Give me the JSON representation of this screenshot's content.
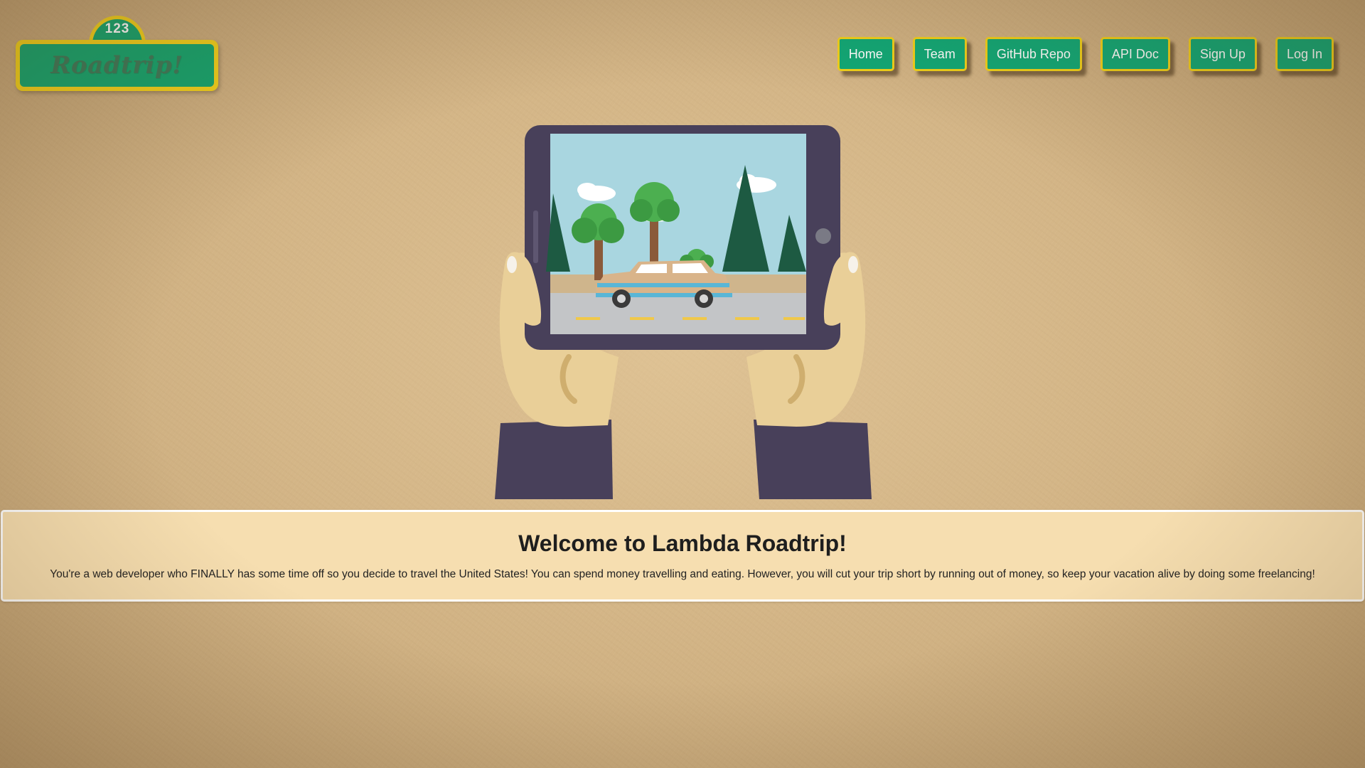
{
  "logo": {
    "number": "123",
    "text": "Roadtrip!"
  },
  "nav": {
    "items": [
      {
        "label": "Home"
      },
      {
        "label": "Team"
      },
      {
        "label": "GitHub Repo"
      },
      {
        "label": "API Doc"
      },
      {
        "label": "Sign Up"
      },
      {
        "label": "Log In"
      }
    ]
  },
  "hero": {
    "illustration": "hands-holding-tablet-with-station-wagon-scene"
  },
  "welcome": {
    "title": "Welcome to Lambda Roadtrip!",
    "description": "You're a web developer who FINALLY has some time off so you decide to travel the United States! You can spend money travelling and eating. However, you will cut your trip short by running out of money, so keep your vacation alive by doing some freelancing!"
  },
  "colors": {
    "accent_green": "#10a876",
    "accent_yellow": "#f0d01a",
    "panel_background": "#f6deb0",
    "page_background": "#d3b486",
    "tablet_frame": "#48405a",
    "sleeve": "#48405a",
    "skin": "#e9cf98"
  }
}
